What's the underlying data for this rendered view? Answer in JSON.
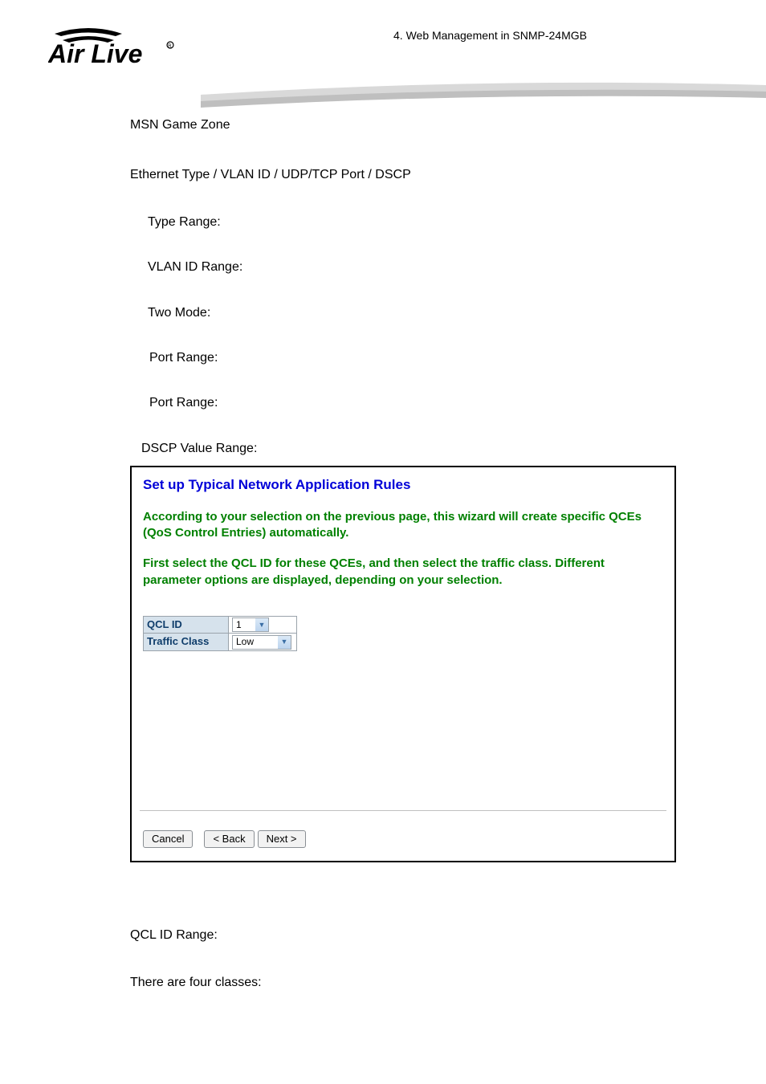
{
  "breadcrumb": "4.  Web  Management  in  SNMP-24MGB",
  "content": {
    "msn": "MSN Game Zone",
    "ethernet_heading": "Ethernet Type / VLAN ID / UDP/TCP Port / DSCP",
    "type_range": "Type Range:",
    "vlan_range": "VLAN ID Range:",
    "two_mode": "Two Mode:",
    "port_range1": "Port Range:",
    "port_range2": "Port Range:",
    "dscp_range": "DSCP Value Range:"
  },
  "wizard": {
    "title": "Set up Typical Network Application Rules",
    "para1": "According to your selection on the previous page, this wizard will create specific QCEs (QoS Control Entries) automatically.",
    "para2": "First select the QCL ID for these QCEs, and then select the traffic class. Different parameter options are displayed, depending on your selection.",
    "form": {
      "qcl_label": "QCL ID",
      "qcl_value": "1",
      "traffic_label": "Traffic Class",
      "traffic_value": "Low"
    },
    "buttons": {
      "cancel": "Cancel",
      "back": "< Back",
      "next": "Next >"
    }
  },
  "footer": {
    "qcl_range": "QCL ID Range:",
    "classes": "There are four classes:"
  }
}
